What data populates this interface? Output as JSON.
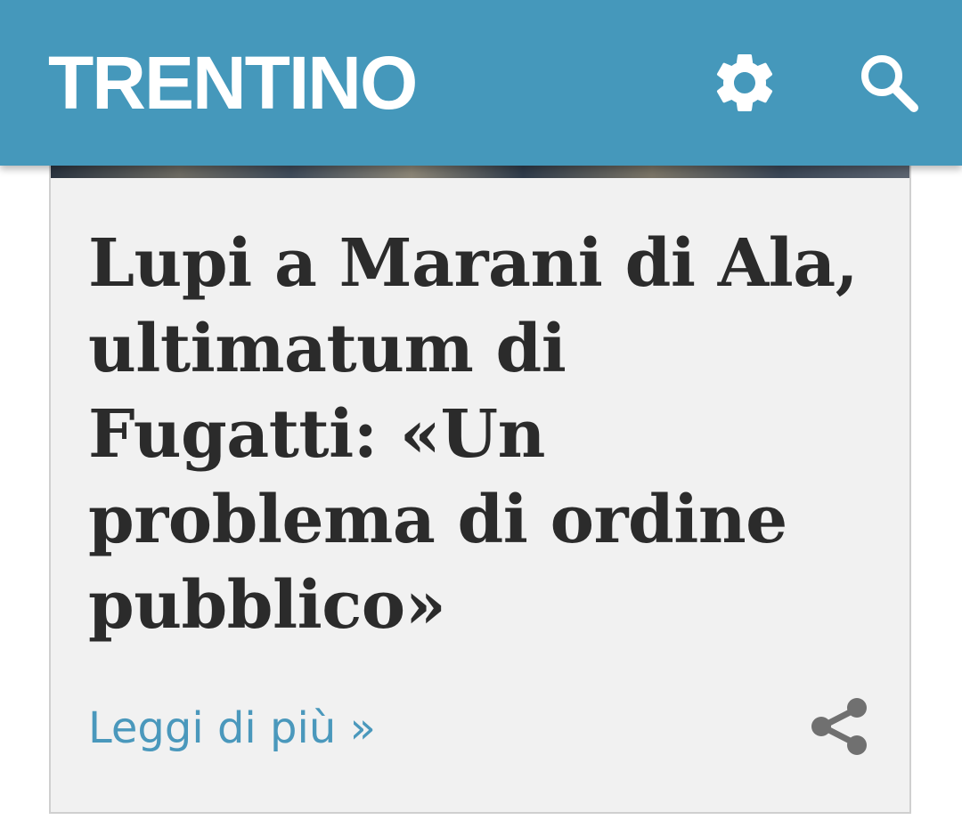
{
  "header": {
    "logo_text": "TRENTINO",
    "settings_icon": "gear-icon",
    "search_icon": "search-icon"
  },
  "article": {
    "headline": "Lupi a Marani di Ala, ultimatum di Fugatti: «Un problema di ordine pubblico»",
    "read_more_label": "Leggi di più »",
    "share_icon": "share-icon"
  },
  "colors": {
    "header_bg": "#4598bb",
    "link": "#4a98bc",
    "headline_text": "#2b2b2b",
    "card_bg": "#f1f1f1"
  }
}
